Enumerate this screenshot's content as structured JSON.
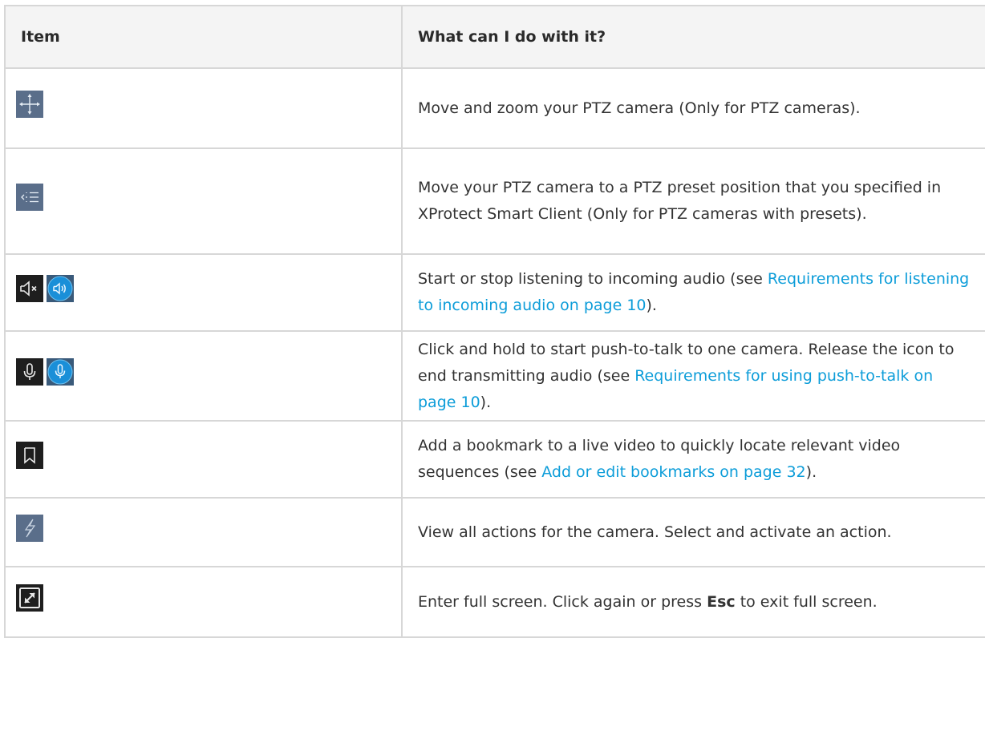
{
  "header": {
    "col1": "Item",
    "col2": "What can I do with it?"
  },
  "rows": [
    {
      "icons": [
        "ptz-move-icon"
      ],
      "text": "Move and zoom your PTZ camera (Only for PTZ cameras)."
    },
    {
      "icons": [
        "ptz-preset-list-icon"
      ],
      "text": "Move your PTZ camera to a PTZ preset position that you specified in XProtect Smart Client (Only for PTZ cameras with presets)."
    },
    {
      "icons": [
        "speaker-muted-icon",
        "speaker-active-icon"
      ],
      "text_before": "Start or stop listening to incoming audio (see ",
      "link": "Requirements for listening to incoming audio on page 10",
      "text_after": ")."
    },
    {
      "icons": [
        "microphone-icon",
        "microphone-active-icon"
      ],
      "text_before": "Click and hold to start push-to-talk to one camera. Release the icon to end transmitting audio (see ",
      "link": "Requirements for using push-to-talk on page 10",
      "text_after": ")."
    },
    {
      "icons": [
        "bookmark-icon"
      ],
      "text_before": "Add a bookmark to a live video to quickly locate relevant video sequences (see ",
      "link": "Add or edit bookmarks on page 32",
      "text_after": ")."
    },
    {
      "icons": [
        "lightning-action-icon"
      ],
      "text": "View all actions for the camera. Select and activate an action."
    },
    {
      "icons": [
        "fullscreen-icon"
      ],
      "text_before": "Enter full screen. Click again or press ",
      "bold": "Esc",
      "text_after": " to exit full screen."
    }
  ],
  "colors": {
    "link": "#0d9dd9",
    "border": "#d7d7d7",
    "header_bg": "#f4f4f4",
    "slate_icon_bg": "#5a6e8a",
    "dark_icon_bg": "#1e1e1e",
    "blue_icon_bg": "#1a8fd8"
  }
}
